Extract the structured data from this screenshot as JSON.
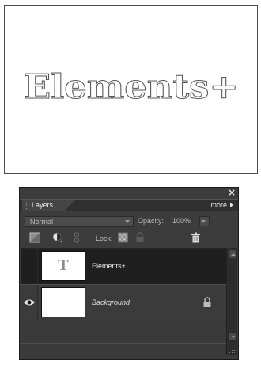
{
  "canvas": {
    "text": "Elements+"
  },
  "panel": {
    "close_label": "×",
    "tab_label": "Layers",
    "more_label": "more",
    "blend_mode": "Normal",
    "opacity_label": "Opacity:",
    "opacity_value": "100%",
    "lock_label": "Lock:",
    "icons": [
      "new-layer-icon",
      "adjustment-layer-icon",
      "link-icon",
      "lock-transparency-icon",
      "lock-all-icon",
      "trash-icon"
    ]
  },
  "layers": [
    {
      "name": "Elements+",
      "type": "text",
      "thumb_glyph": "T",
      "visible": false,
      "selected": true,
      "locked": false
    },
    {
      "name": "Background",
      "type": "image",
      "thumb_glyph": "",
      "visible": true,
      "selected": false,
      "locked": true
    }
  ],
  "colors": {
    "panel_bg": "#3c3c3c",
    "selected_row": "#1f1f1f",
    "text_light": "#ececec"
  }
}
